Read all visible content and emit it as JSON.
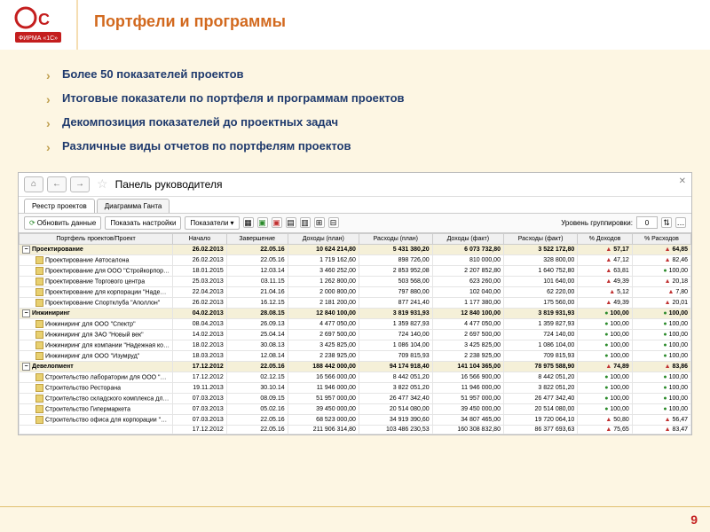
{
  "slide": {
    "title": "Портфели и программы",
    "bullets": [
      "Более 50 показателей проектов",
      "Итоговые показатели по портфеля и программам проектов",
      "Декомпозиция показателей до проектных задач",
      "Различные виды отчетов по портфелям проектов"
    ],
    "page_number": "9"
  },
  "app": {
    "title": "Панель руководителя",
    "tabs": [
      "Реестр проектов",
      "Диаграмма Ганта"
    ],
    "toolbar": {
      "refresh": "Обновить данные",
      "show_settings": "Показать настройки",
      "indicators": "Показатели",
      "grouping_label": "Уровень группировки:",
      "grouping_value": "0"
    },
    "columns": [
      "Портфель проектов/Проект",
      "Начало",
      "Завершение",
      "Доходы (план)",
      "Расходы (план)",
      "Доходы (факт)",
      "Расходы (факт)",
      "% Доходов",
      "% Расходов"
    ],
    "groups": [
      {
        "name": "Проектирование",
        "expand": "−",
        "row": [
          "26.02.2013",
          "22.05.16",
          "10 624 214,80",
          "5 431 380,20",
          "6 073 732,80",
          "3 522 172,80",
          "57,17",
          "64,85"
        ],
        "children": [
          {
            "name": "Проектирование Автосалона",
            "row": [
              "26.02.2013",
              "22.05.16",
              "1 719 162,60",
              "898 726,00",
              "810 000,00",
              "328 800,00",
              "47,12",
              "82,46"
            ]
          },
          {
            "name": "Проектирование для ООО \"Стройкорпорац…",
            "row": [
              "18.01.2015",
              "12.03.14",
              "3 460 252,00",
              "2 853 952,08",
              "2 207 852,80",
              "1 640 752,80",
              "63,81",
              "100,00"
            ]
          },
          {
            "name": "Проектирование Торгового центра",
            "row": [
              "25.03.2013",
              "03.11.15",
              "1 262 800,00",
              "503 568,00",
              "623 260,00",
              "101 640,00",
              "49,39",
              "20,18"
            ]
          },
          {
            "name": "Проектирование для корпорации \"Надежн…",
            "row": [
              "22.04.2013",
              "21.04.16",
              "2 000 800,00",
              "797 880,00",
              "102 040,00",
              "62 220,00",
              "5,12",
              "7,80"
            ]
          },
          {
            "name": "Проектирование Спортклуба \"Аполлон\"",
            "row": [
              "26.02.2013",
              "16.12.15",
              "2 181 200,00",
              "877 241,40",
              "1 177 380,00",
              "175 560,00",
              "49,39",
              "20,01"
            ]
          }
        ]
      },
      {
        "name": "Инжиниринг",
        "expand": "−",
        "row": [
          "04.02.2013",
          "28.08.15",
          "12 840 100,00",
          "3 819 931,93",
          "12 840 100,00",
          "3 819 931,93",
          "100,00",
          "100,00"
        ],
        "children": [
          {
            "name": "Инжиниринг для ООО \"Спектр\"",
            "row": [
              "08.04.2013",
              "26.09.13",
              "4 477 050,00",
              "1 359 827,93",
              "4 477 050,00",
              "1 359 827,93",
              "100,00",
              "100,00"
            ]
          },
          {
            "name": "Инжиниринг для ЗАО \"Новый век\"",
            "row": [
              "14.02.2013",
              "25.04.14",
              "2 697 500,00",
              "724 140,00",
              "2 697 500,00",
              "724 140,00",
              "100,00",
              "100,00"
            ]
          },
          {
            "name": "Инжиниринг для компании \"Надежная кон…",
            "row": [
              "18.02.2013",
              "30.08.13",
              "3 425 825,00",
              "1 086 104,00",
              "3 425 825,00",
              "1 086 104,00",
              "100,00",
              "100,00"
            ]
          },
          {
            "name": "Инжиниринг для ООО \"Изумруд\"",
            "row": [
              "18.03.2013",
              "12.08.14",
              "2 238 925,00",
              "709 815,93",
              "2 238 925,00",
              "709 815,93",
              "100,00",
              "100,00"
            ]
          }
        ]
      },
      {
        "name": "Девелопмент",
        "expand": "−",
        "row": [
          "17.12.2012",
          "22.05.16",
          "188 442 000,00",
          "94 174 918,40",
          "141 104 365,00",
          "78 975 588,90",
          "74,89",
          "83,86"
        ],
        "children": [
          {
            "name": "Строительство лаборатории для ООО \"Спе…",
            "row": [
              "17.12.2012",
              "02.12.15",
              "16 566 000,00",
              "8 442 051,20",
              "16 566 900,00",
              "8 442 051,20",
              "100,00",
              "100,00"
            ]
          },
          {
            "name": "Строительство Ресторана",
            "row": [
              "19.11.2013",
              "30.10.14",
              "11 946 000,00",
              "3 822 051,20",
              "11 946 000,00",
              "3 822 051,20",
              "100,00",
              "100,00"
            ]
          },
          {
            "name": "Строительство складского комплекса для …",
            "row": [
              "07.03.2013",
              "08.09.15",
              "51 957 000,00",
              "26 477 342,40",
              "51 957 000,00",
              "26 477 342,40",
              "100,00",
              "100,00"
            ]
          },
          {
            "name": "Строительство Гипермаркета",
            "row": [
              "07.03.2013",
              "05.02.16",
              "39 450 000,00",
              "20 514 080,00",
              "39 450 000,00",
              "20 514 080,00",
              "100,00",
              "100,00"
            ]
          },
          {
            "name": "Строительство офиса для корпорации \"Н…",
            "row": [
              "07.03.2013",
              "22.05.16",
              "68 523 000,00",
              "34 919 390,60",
              "34 807 465,00",
              "19 720 064,10",
              "50,80",
              "56,47"
            ]
          },
          {
            "name": "",
            "row": [
              "17.12.2012",
              "22.05.16",
              "211 906 314,80",
              "103 486 230,53",
              "160 308 832,80",
              "86 377 693,63",
              "75,65",
              "83,47"
            ]
          }
        ]
      }
    ]
  }
}
